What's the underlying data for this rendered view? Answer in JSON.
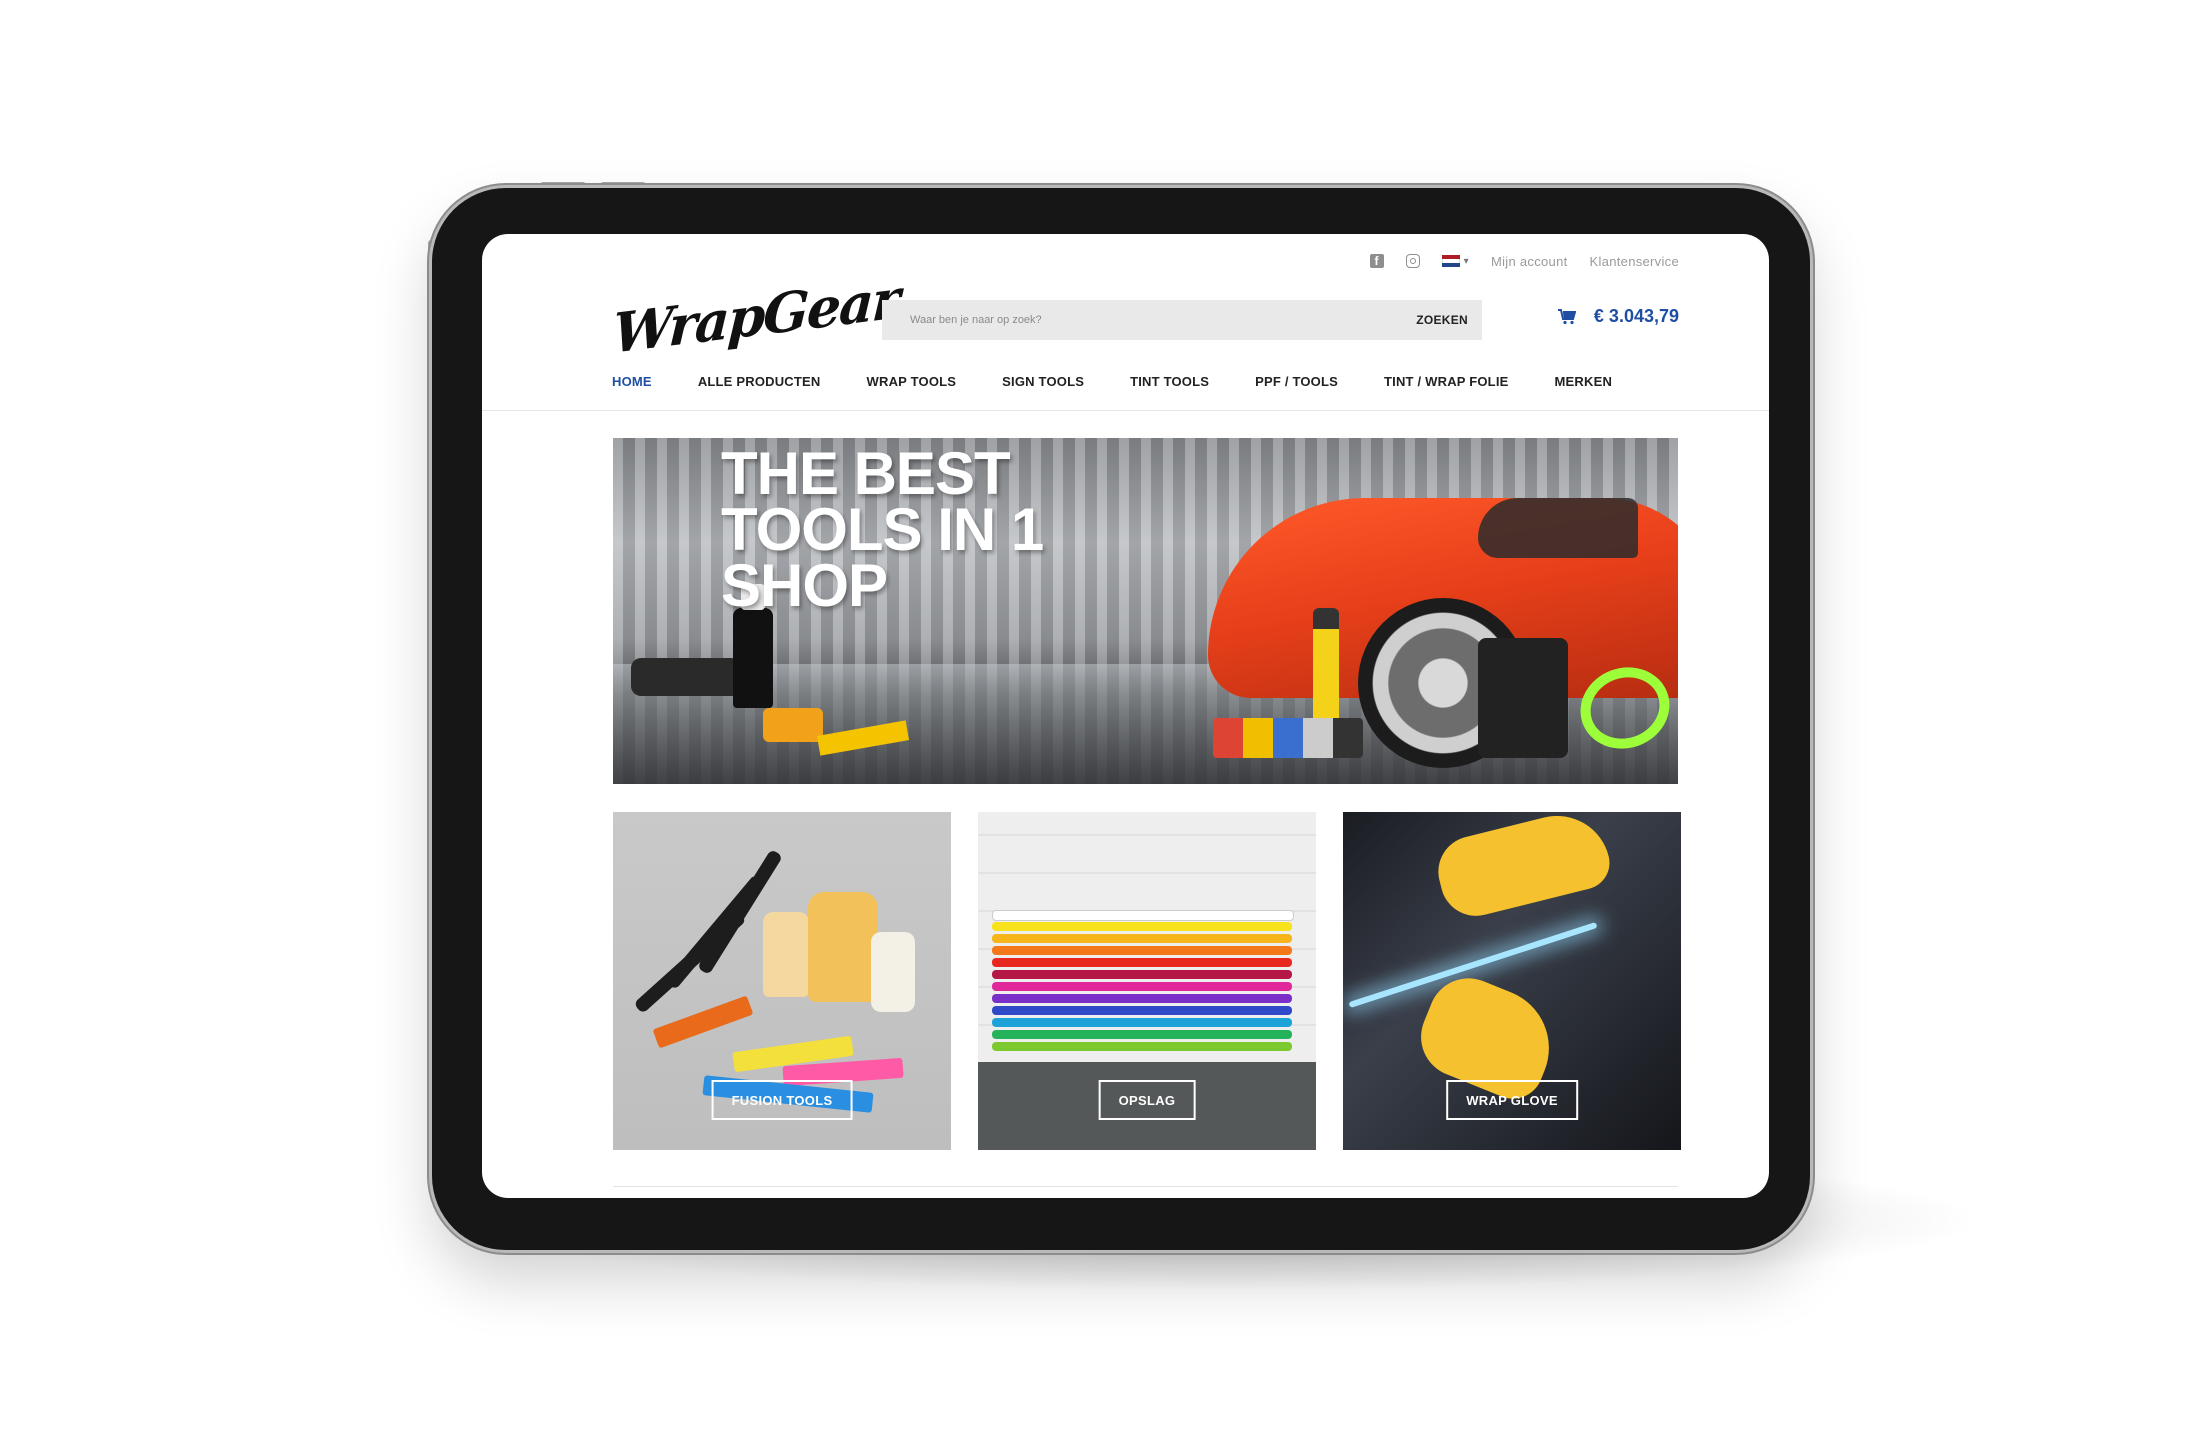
{
  "header": {
    "logo": "WrapGear",
    "topbar": {
      "social": [
        "facebook-icon",
        "instagram-icon"
      ],
      "language_flag": "nl-flag",
      "my_account": "Mijn account",
      "customer_service": "Klantenservice"
    },
    "search": {
      "placeholder": "Waar ben je naar op zoek?",
      "button": "ZOEKEN"
    },
    "cart": {
      "total": "€ 3.043,79"
    }
  },
  "nav": [
    {
      "label": "HOME",
      "active": true
    },
    {
      "label": "ALLE PRODUCTEN"
    },
    {
      "label": "WRAP TOOLS"
    },
    {
      "label": "SIGN TOOLS"
    },
    {
      "label": "TINT TOOLS"
    },
    {
      "label": "PPF / TOOLS"
    },
    {
      "label": "TINT / WRAP FOLIE"
    },
    {
      "label": "MERKEN"
    }
  ],
  "hero": {
    "headline": "THE BEST TOOLS IN 1 SHOP"
  },
  "tiles": [
    {
      "label": "FUSION TOOLS"
    },
    {
      "label": "OPSLAG"
    },
    {
      "label": "WRAP GLOVE"
    }
  ],
  "colors": {
    "accent": "#1e4fa3",
    "text": "#222222",
    "muted": "#9a9a9a",
    "flag": [
      "#ae1c28",
      "#ffffff",
      "#21468b"
    ]
  }
}
